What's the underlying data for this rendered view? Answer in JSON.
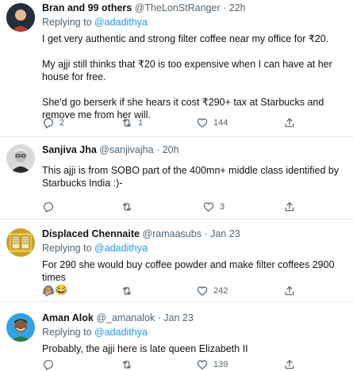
{
  "tweets": [
    {
      "name": "Bran and 99 others",
      "handle": "@TheLonStRanger",
      "sep": "·",
      "time": "22h",
      "reply_prefix": "Replying to",
      "reply_to": "@adadithya",
      "paragraphs": [
        "I get very authentic and strong filter coffee near my office for ₹20.",
        "My ajji still thinks that ₹20 is too expensive when I can have at her house for free.",
        "She'd go berserk if she hears it cost ₹290+ tax at Starbucks and remove me from her will."
      ],
      "replies": "2",
      "retweets": "1",
      "likes": "144"
    },
    {
      "name": "Sanjiva Jha",
      "handle": "@sanjivajha",
      "sep": "·",
      "time": "20h",
      "reply_prefix": "",
      "reply_to": "",
      "paragraphs": [
        "This ajji is from SOBO part of the 400mn+ middle class identified by Starbucks India :)-"
      ],
      "replies": "",
      "retweets": "",
      "likes": "3"
    },
    {
      "name": "Displaced Chennaite",
      "handle": "@ramaasubs",
      "sep": "·",
      "time": "Jan 23",
      "reply_prefix": "Replying to",
      "reply_to": "@adadithya",
      "paragraphs": [
        "For 290 she would buy coffee powder and make filter coffees 2900 times"
      ],
      "emojis": "🙈😂",
      "replies": "",
      "retweets": "",
      "likes": "242"
    },
    {
      "name": "Aman Alok",
      "handle": "@_amanalok",
      "sep": "·",
      "time": "Jan 23",
      "reply_prefix": "Replying to",
      "reply_to": "@adadithya",
      "paragraphs": [
        "Probably, the ajji here is late queen Elizabeth II"
      ],
      "replies": "",
      "retweets": "",
      "likes": "139"
    }
  ],
  "icons": {
    "reply": "reply-icon",
    "retweet": "retweet-icon",
    "like": "heart-icon",
    "share": "share-icon"
  },
  "colors": {
    "link": "#1d9bf0",
    "secondary": "#536471",
    "text": "#0f1419",
    "divider": "#e6ecf0"
  }
}
